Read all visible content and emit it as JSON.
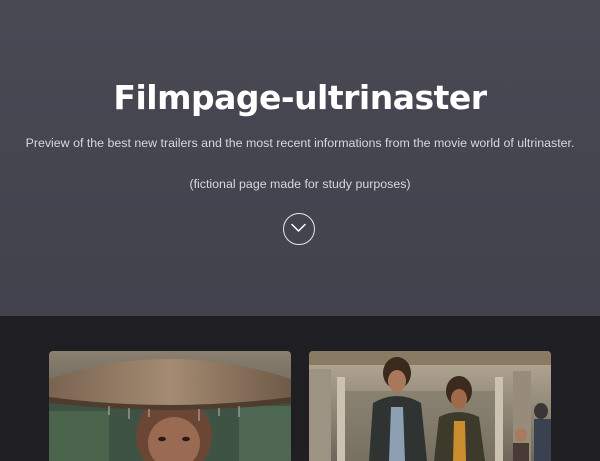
{
  "hero": {
    "title": "Filmpage-ultrinaster",
    "subtitle": "Preview of the best new trailers and the most recent informations from the movie world of ultrinaster.",
    "note": "(fictional page made for study purposes)",
    "scroll_icon": "chevron-down-icon"
  },
  "cards": [
    {
      "image": "movie-poster-woman-with-straw-hat"
    },
    {
      "image": "movie-still-two-men-in-hall"
    }
  ],
  "colors": {
    "hero_background": "#45454f",
    "content_background": "#1e1e23",
    "title": "#ffffff",
    "text": "#d7d7de"
  }
}
